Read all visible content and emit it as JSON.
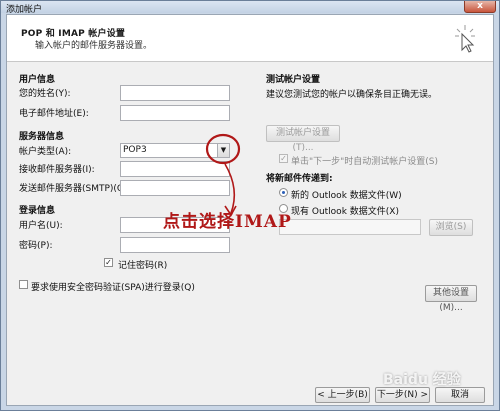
{
  "window": {
    "title": "添加帐户",
    "close_label": "x"
  },
  "header": {
    "title": "POP 和 IMAP 帐户设置",
    "subtitle": "输入帐户的邮件服务器设置。"
  },
  "user_info": {
    "section": "用户信息",
    "name_label": "您的姓名(Y):",
    "name_value": "",
    "email_label": "电子邮件地址(E):",
    "email_value": ""
  },
  "server_info": {
    "section": "服务器信息",
    "account_type_label": "帐户类型(A):",
    "account_type_value": "POP3",
    "incoming_label": "接收邮件服务器(I):",
    "incoming_value": "",
    "outgoing_label": "发送邮件服务器(SMTP)(O):",
    "outgoing_value": ""
  },
  "login_info": {
    "section": "登录信息",
    "username_label": "用户名(U):",
    "username_value": "",
    "password_label": "密码(P):",
    "password_value": "",
    "remember_label": "记住密码(R)",
    "remember_checked": true
  },
  "spa": {
    "label": "要求使用安全密码验证(SPA)进行登录(Q)",
    "checked": false
  },
  "test": {
    "section": "测试帐户设置",
    "description": "建议您测试您的帐户以确保条目正确无误。",
    "button": "测试帐户设置(T)...",
    "auto_test_label": "单击\"下一步\"时自动测试帐户设置(S)",
    "auto_test_checked": true
  },
  "deliver": {
    "section": "将新邮件传递到:",
    "option_new": "新的 Outlook 数据文件(W)",
    "option_existing": "现有 Outlook 数据文件(X)",
    "selected": "new",
    "browse_button": "浏览(S)",
    "path_value": ""
  },
  "more_settings_button": "其他设置(M)...",
  "nav": {
    "back_button": "< 上一步(B)",
    "next_button": "下一步(N) >",
    "cancel_button": "取消"
  },
  "annotation": {
    "text": "点击选择IMAP",
    "color": "#b01818"
  },
  "watermark": {
    "text": "Baidu 经验"
  },
  "colors": {
    "window_frame": "#c9d6e6",
    "dialog_bg": "#f0f0f0",
    "annotation_red": "#b01818"
  }
}
